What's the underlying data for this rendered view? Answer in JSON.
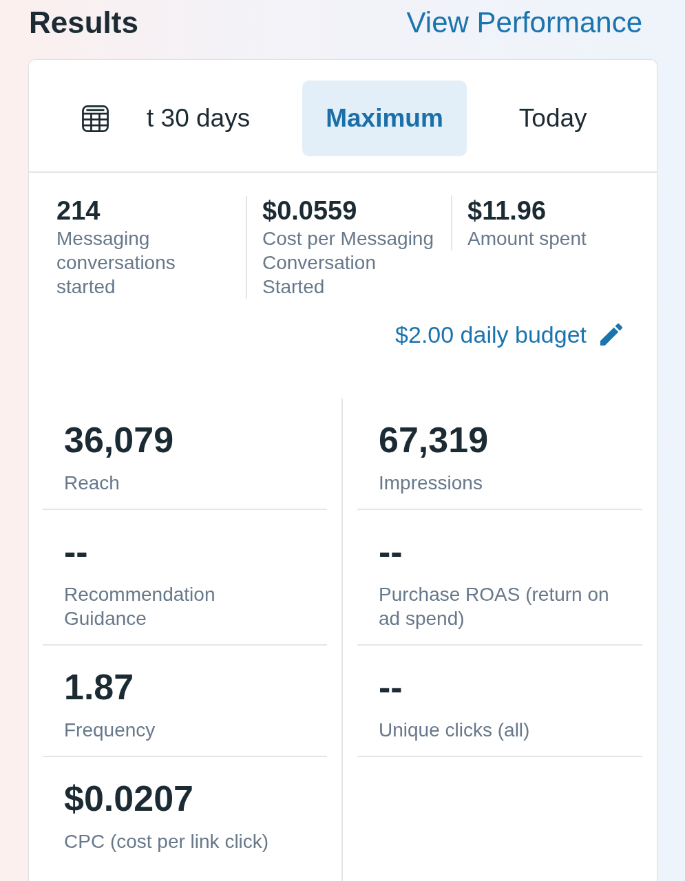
{
  "header": {
    "title": "Results",
    "link": "View Performance"
  },
  "date_tabs": [
    {
      "label": "t 30 days",
      "selected": false
    },
    {
      "label": "Maximum",
      "selected": true
    },
    {
      "label": "Today",
      "selected": false
    }
  ],
  "summary": [
    {
      "value": "214",
      "label": "Messaging conversations started"
    },
    {
      "value": "$0.0559",
      "label": "Cost per Messaging Conversation Started"
    },
    {
      "value": "$11.96",
      "label": "Amount spent"
    }
  ],
  "budget": {
    "text": "$2.00 daily budget"
  },
  "metrics": [
    {
      "value": "36,079",
      "label": "Reach"
    },
    {
      "value": "67,319",
      "label": "Impressions"
    },
    {
      "value": "--",
      "label": "Recommendation Guidance"
    },
    {
      "value": "--",
      "label": "Purchase ROAS (return on ad spend)"
    },
    {
      "value": "1.87",
      "label": "Frequency"
    },
    {
      "value": "--",
      "label": "Unique clicks (all)"
    },
    {
      "value": "$0.0207",
      "label": "CPC (cost per link click)"
    }
  ]
}
